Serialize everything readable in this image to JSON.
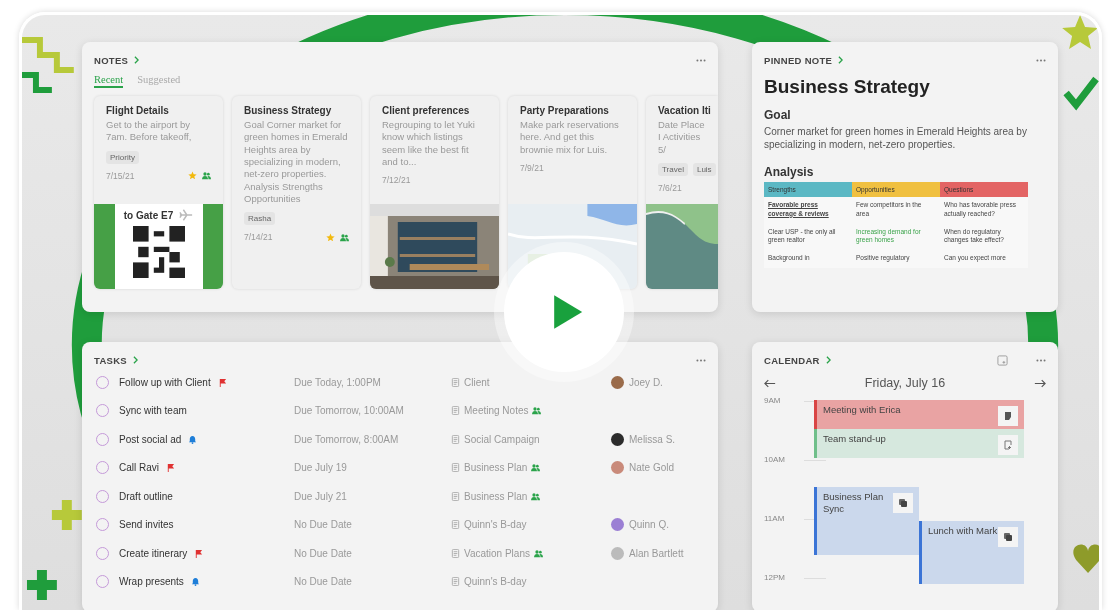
{
  "notes": {
    "title": "NOTES",
    "tabs": [
      {
        "label": "Recent",
        "selected": true
      },
      {
        "label": "Suggested",
        "selected": false
      }
    ],
    "cards": [
      {
        "title": "Flight Details",
        "body": "Get to the airport by 7am. Before takeoff,",
        "tags": [
          "Priority"
        ],
        "date": "7/15/21",
        "starred": true,
        "shared": true,
        "thumbnail": {
          "kind": "boarding_pass",
          "text": "to Gate E7"
        }
      },
      {
        "title": "Business Strategy",
        "body": "Goal Corner market for green homes in Emerald Heights area by specializing in modern, net-zero properties. Analysis Strengths Opportunities",
        "tags": [
          "Rasha"
        ],
        "date": "7/14/21",
        "starred": true,
        "shared": true
      },
      {
        "title": "Client preferences",
        "body": "Regrouping to let Yuki know which listings seem like the best fit and to...",
        "date": "7/12/21",
        "starred": false,
        "shared": false,
        "thumbnail": {
          "kind": "room"
        }
      },
      {
        "title": "Party Preparations",
        "body": "Make park reservations here. And get this brownie mix for Luis.",
        "date": "7/9/21",
        "starred": false,
        "shared": false,
        "thumbnail": {
          "kind": "map"
        }
      },
      {
        "title": "Vacation Iti",
        "body": "Date Place I Activities 5/",
        "tags": [
          "Travel",
          "Luis"
        ],
        "date": "7/6/21",
        "starred": false,
        "shared": false,
        "thumbnail": {
          "kind": "coast"
        }
      }
    ]
  },
  "pinned_note": {
    "label": "PINNED NOTE",
    "title": "Business Strategy",
    "goal_heading": "Goal",
    "goal_text": "Corner market for green homes in Emerald Heights area by specializing in modern, net-zero properties.",
    "analysis_heading": "Analysis",
    "table": {
      "columns": [
        {
          "label": "Strengths",
          "color": "#5bb8c4"
        },
        {
          "label": "Opportunities",
          "color": "#f0c040"
        },
        {
          "label": "Questions",
          "color": "#e36464"
        }
      ],
      "rows": [
        [
          {
            "text": "Favorable press coverage & reviews",
            "kind": "link"
          },
          {
            "text": "Few competitors in the area",
            "kind": "plain"
          },
          {
            "text": "Who has favorable press actually reached?",
            "kind": "plain"
          }
        ],
        [
          {
            "text": "Clear USP - the only all green realtor",
            "kind": "plain"
          },
          {
            "text": "Increasing demand for green homes",
            "kind": "highlight"
          },
          {
            "text": "When do regulatory changes take effect?",
            "kind": "plain"
          }
        ],
        [
          {
            "text": "Background in",
            "kind": "plain"
          },
          {
            "text": "Positive regulatory",
            "kind": "plain"
          },
          {
            "text": "Can you expect more",
            "kind": "plain"
          }
        ]
      ]
    }
  },
  "tasks": {
    "title": "TASKS",
    "rows": [
      {
        "title": "Follow up with Client",
        "checked": false,
        "flagged": true,
        "reminder": false,
        "due": "Due Today, 1:00PM",
        "note": "Client",
        "shared": false,
        "assignee": {
          "name": "Joey D.",
          "color": "#9a6b4a"
        }
      },
      {
        "title": "Sync with team",
        "checked": false,
        "flagged": false,
        "reminder": false,
        "due": "Due Tomorrow, 10:00AM",
        "note": "Meeting Notes",
        "shared": true
      },
      {
        "title": "Post social ad",
        "checked": false,
        "flagged": false,
        "reminder": true,
        "due": "Due Tomorrow, 8:00AM",
        "note": "Social Campaign",
        "shared": false,
        "assignee": {
          "name": "Melissa S.",
          "color": "#2b2b2b"
        }
      },
      {
        "title": "Call Ravi",
        "checked": false,
        "flagged": true,
        "reminder": false,
        "due": "Due July 19",
        "note": "Business Plan",
        "shared": true,
        "assignee": {
          "name": "Nate Gold",
          "color": "#c98a7a"
        }
      },
      {
        "title": "Draft outline",
        "checked": false,
        "flagged": false,
        "reminder": false,
        "due": "Due July 21",
        "note": "Business Plan",
        "shared": true
      },
      {
        "title": "Send invites",
        "checked": false,
        "flagged": false,
        "reminder": false,
        "due": "No Due Date",
        "note": "Quinn's B-day",
        "shared": false,
        "assignee": {
          "name": "Quinn Q.",
          "color": "#9b7fd4"
        }
      },
      {
        "title": "Create itinerary",
        "checked": false,
        "flagged": true,
        "reminder": false,
        "due": "No Due Date",
        "note": "Vacation Plans",
        "shared": true,
        "assignee": {
          "name": "Alan Bartlett",
          "color": "#bbbbbb"
        }
      },
      {
        "title": "Wrap presents",
        "checked": false,
        "flagged": false,
        "reminder": true,
        "due": "No Due Date",
        "note": "Quinn's B-day",
        "shared": false
      }
    ]
  },
  "calendar": {
    "title": "CALENDAR",
    "date": "Friday, July 16",
    "hours": [
      "9AM",
      "10AM",
      "11AM",
      "12PM"
    ],
    "events": [
      {
        "title": "Meeting with Erica",
        "color": "#e9a3a3"
      },
      {
        "title": "Team stand-up",
        "color": "#d6e8de"
      },
      {
        "title": "Business Plan Sync",
        "color": "#cbd8ec"
      },
      {
        "title": "Lunch with Mark",
        "color": "#cbd8ec"
      }
    ]
  }
}
